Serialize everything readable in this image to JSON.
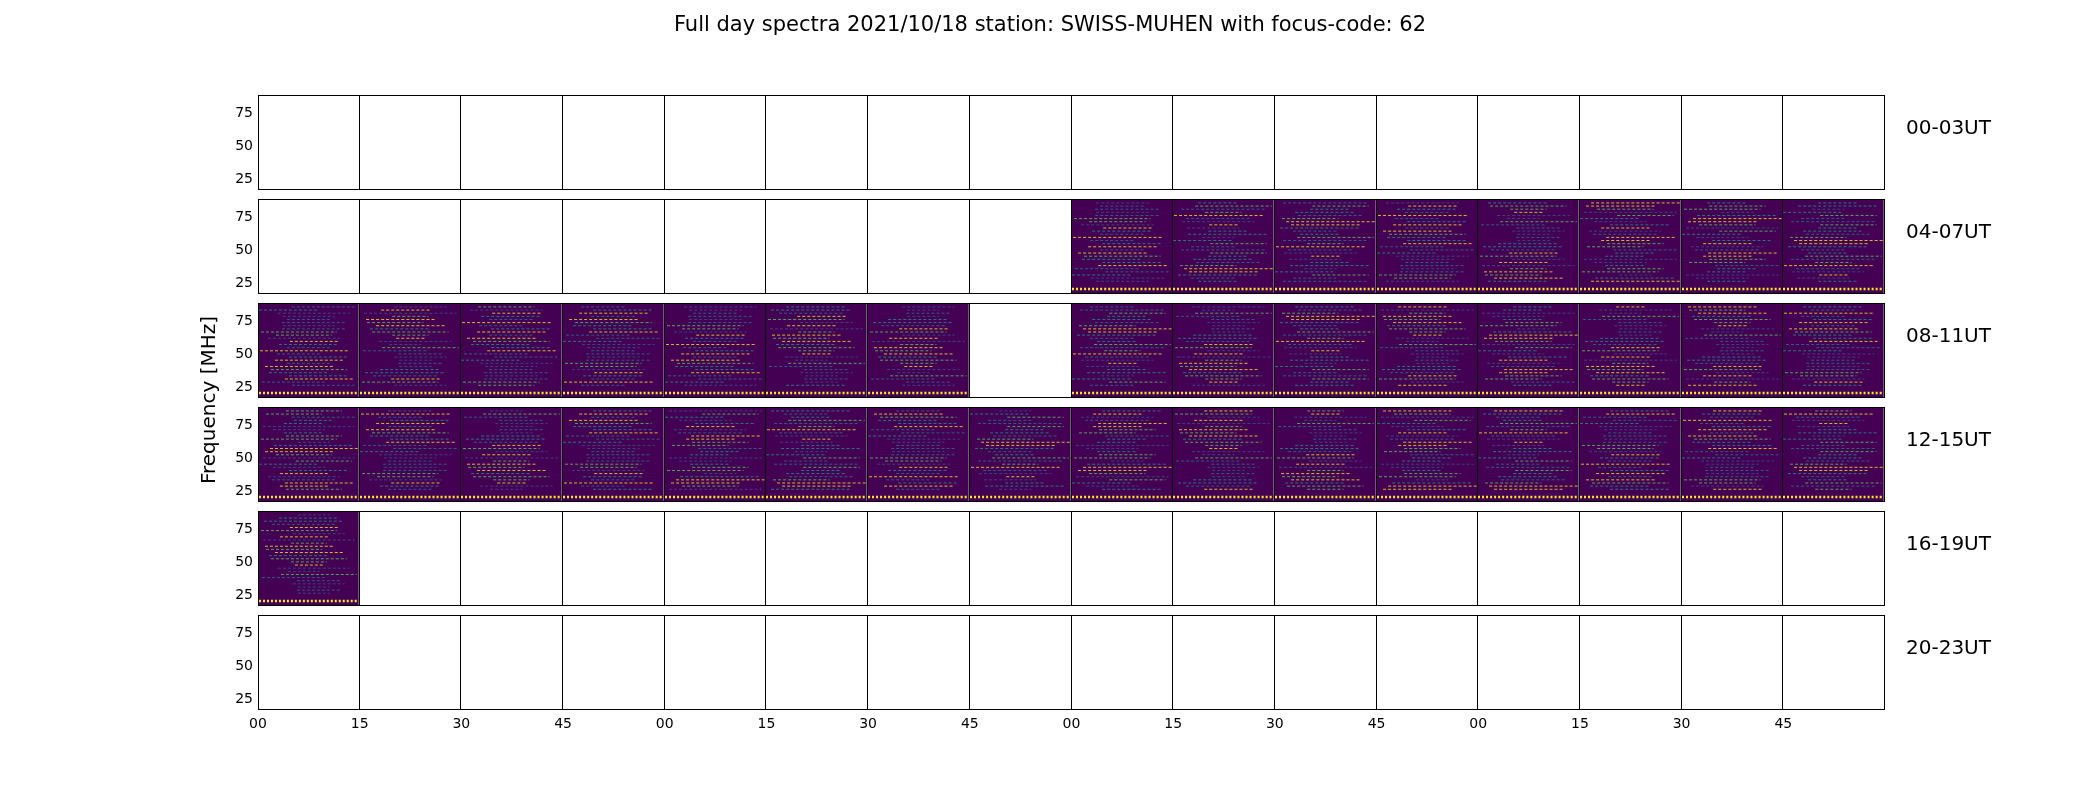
{
  "title": "Full day spectra 2021/10/18 station: SWISS-MUHEN with focus-code: 62",
  "y_axis_label": "Frequency [MHz]",
  "rows": [
    {
      "label": "00-03UT",
      "y_ticks": [
        "75",
        "50",
        "25"
      ],
      "panels": [
        {
          "has_data": false
        },
        {
          "has_data": false
        },
        {
          "has_data": false
        },
        {
          "has_data": false
        },
        {
          "has_data": false
        },
        {
          "has_data": false
        },
        {
          "has_data": false
        },
        {
          "has_data": false
        },
        {
          "has_data": false
        },
        {
          "has_data": false
        },
        {
          "has_data": false
        },
        {
          "has_data": false
        },
        {
          "has_data": false
        },
        {
          "has_data": false
        },
        {
          "has_data": false
        },
        {
          "has_data": false
        }
      ]
    },
    {
      "label": "04-07UT",
      "y_ticks": [
        "75",
        "50",
        "25"
      ],
      "panels": [
        {
          "has_data": false
        },
        {
          "has_data": false
        },
        {
          "has_data": false
        },
        {
          "has_data": false
        },
        {
          "has_data": false
        },
        {
          "has_data": false
        },
        {
          "has_data": false
        },
        {
          "has_data": false
        },
        {
          "has_data": true
        },
        {
          "has_data": true
        },
        {
          "has_data": true
        },
        {
          "has_data": true
        },
        {
          "has_data": true
        },
        {
          "has_data": true
        },
        {
          "has_data": true
        },
        {
          "has_data": true
        }
      ]
    },
    {
      "label": "08-11UT",
      "y_ticks": [
        "75",
        "50",
        "25"
      ],
      "panels": [
        {
          "has_data": true
        },
        {
          "has_data": true
        },
        {
          "has_data": true
        },
        {
          "has_data": true
        },
        {
          "has_data": true
        },
        {
          "has_data": true
        },
        {
          "has_data": true
        },
        {
          "has_data": false
        },
        {
          "has_data": true
        },
        {
          "has_data": true
        },
        {
          "has_data": true
        },
        {
          "has_data": true
        },
        {
          "has_data": true
        },
        {
          "has_data": true
        },
        {
          "has_data": true
        },
        {
          "has_data": true
        }
      ]
    },
    {
      "label": "12-15UT",
      "y_ticks": [
        "75",
        "50",
        "25"
      ],
      "panels": [
        {
          "has_data": true
        },
        {
          "has_data": true
        },
        {
          "has_data": true
        },
        {
          "has_data": true
        },
        {
          "has_data": true
        },
        {
          "has_data": true
        },
        {
          "has_data": true
        },
        {
          "has_data": true
        },
        {
          "has_data": true
        },
        {
          "has_data": true
        },
        {
          "has_data": true
        },
        {
          "has_data": true
        },
        {
          "has_data": true
        },
        {
          "has_data": true
        },
        {
          "has_data": true
        },
        {
          "has_data": true
        }
      ]
    },
    {
      "label": "16-19UT",
      "y_ticks": [
        "75",
        "50",
        "25"
      ],
      "panels": [
        {
          "has_data": true
        },
        {
          "has_data": false
        },
        {
          "has_data": false
        },
        {
          "has_data": false
        },
        {
          "has_data": false
        },
        {
          "has_data": false
        },
        {
          "has_data": false
        },
        {
          "has_data": false
        },
        {
          "has_data": false
        },
        {
          "has_data": false
        },
        {
          "has_data": false
        },
        {
          "has_data": false
        },
        {
          "has_data": false
        },
        {
          "has_data": false
        },
        {
          "has_data": false
        },
        {
          "has_data": false
        }
      ]
    },
    {
      "label": "20-23UT",
      "y_ticks": [
        "75",
        "50",
        "25"
      ],
      "panels": [
        {
          "has_data": false
        },
        {
          "has_data": false
        },
        {
          "has_data": false
        },
        {
          "has_data": false
        },
        {
          "has_data": false
        },
        {
          "has_data": false
        },
        {
          "has_data": false
        },
        {
          "has_data": false
        },
        {
          "has_data": false
        },
        {
          "has_data": false
        },
        {
          "has_data": false
        },
        {
          "has_data": false
        },
        {
          "has_data": false
        },
        {
          "has_data": false
        },
        {
          "has_data": false
        },
        {
          "has_data": false
        }
      ]
    }
  ],
  "x_ticks": [
    "00",
    "15",
    "30",
    "45",
    "00",
    "15",
    "30",
    "45",
    "00",
    "15",
    "30",
    "45",
    "00",
    "15",
    "30",
    "45"
  ]
}
